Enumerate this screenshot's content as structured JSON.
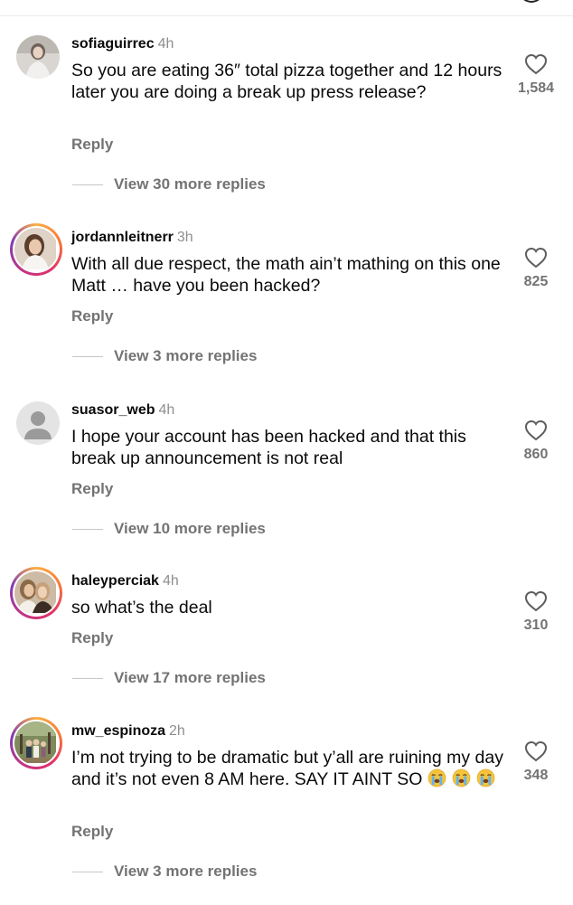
{
  "comments": [
    {
      "username": "sofiaguirrec",
      "time": "4h",
      "text": "So you are eating 36″ total  pizza together and 12 hours later you are doing a break up press release?",
      "reply_label": "Reply",
      "view_replies": "View 30 more replies",
      "likes": "1,584",
      "avatar": "photo"
    },
    {
      "username": "jordannleitnerr",
      "time": "3h",
      "text": "With all due respect, the math ain’t mathing on this one Matt … have you been hacked?",
      "reply_label": "Reply",
      "view_replies": "View 3 more replies",
      "likes": "825",
      "avatar": "story-ring-photo"
    },
    {
      "username": "suasor_web",
      "time": "4h",
      "text": "I hope your account has been hacked and that this break up announcement is not real",
      "reply_label": "Reply",
      "view_replies": "View 10 more replies",
      "likes": "860",
      "avatar": "default-person-icon"
    },
    {
      "username": "haleyperciak",
      "time": "4h",
      "text": "so what’s the deal",
      "reply_label": "Reply",
      "view_replies": "View 17 more replies",
      "likes": "310",
      "avatar": "story-ring-photo"
    },
    {
      "username": "mw_espinoza",
      "time": "2h",
      "text": "I’m not trying to be dramatic but y’all are ruining my day and it’s not even 8 AM here. SAY IT AINT SO",
      "emoji": "😭😭😭",
      "reply_label": "Reply",
      "view_replies": "View 3 more replies",
      "likes": "348",
      "avatar": "story-ring-photo"
    }
  ],
  "icons": {
    "like": "heart-outline-icon",
    "crying_emoji": "loudly-crying-face-icon"
  },
  "colors": {
    "text": "#0a0a0a",
    "secondary": "#737373",
    "ring": "#e1306c"
  }
}
